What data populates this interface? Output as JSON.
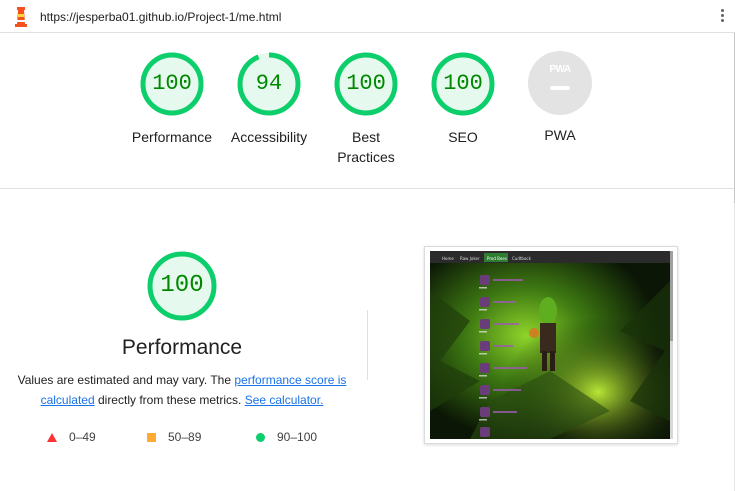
{
  "browser": {
    "url": "https://jesperba01.github.io/Project-1/me.html",
    "logo_icon": "lighthouse-icon",
    "menu_icon": "kebab-menu-icon"
  },
  "colors": {
    "pass": "#0cce6b",
    "pass_text": "#008800",
    "average": "#ffaa33",
    "fail": "#ff3333",
    "pwa_gray": "#e3e3e3",
    "link": "#1a73e8"
  },
  "gauges": [
    {
      "score": "100",
      "label": "Performance",
      "fraction": 1.0
    },
    {
      "score": "94",
      "label": "Accessibility",
      "fraction": 0.94
    },
    {
      "score": "100",
      "label": "Best Practices",
      "fraction": 1.0
    },
    {
      "score": "100",
      "label": "SEO",
      "fraction": 1.0
    }
  ],
  "pwa": {
    "label": "PWA",
    "badge_text": "PWA"
  },
  "performance": {
    "score": "100",
    "fraction": 1.0,
    "title": "Performance",
    "note_prefix": "Values are estimated and may vary. The ",
    "note_link1": "performance score is calculated",
    "note_middle": " directly from these metrics. ",
    "note_link2": "See calculator."
  },
  "legend": [
    {
      "range": "0–49",
      "shape": "triangle",
      "color": "#ff3333"
    },
    {
      "range": "50–89",
      "shape": "square",
      "color": "#ffaa33"
    },
    {
      "range": "90–100",
      "shape": "circle",
      "color": "#0cce6b"
    }
  ],
  "screenshot": {
    "nav": [
      "Home",
      "Raw Joker",
      "Prod Bees",
      "Cudtback"
    ],
    "active_nav": "Prod Bees"
  }
}
